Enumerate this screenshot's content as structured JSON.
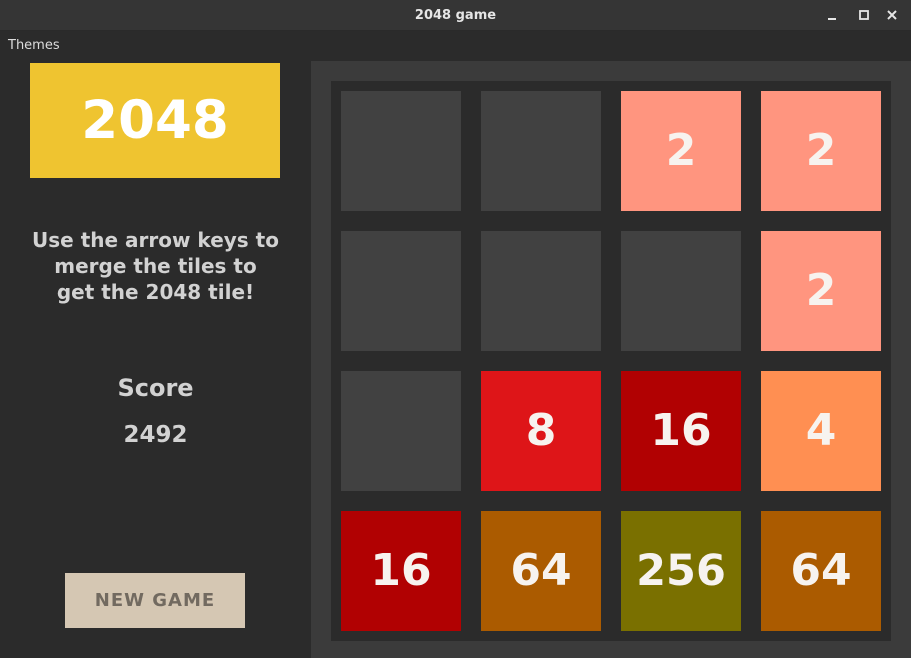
{
  "window": {
    "title": "2048 game"
  },
  "menubar": {
    "items": [
      "Themes"
    ]
  },
  "sidebar": {
    "logo": "2048",
    "instructions": [
      "Use the arrow keys to",
      "merge the tiles to",
      "get the 2048 tile!"
    ],
    "score_label": "Score",
    "score_value": "2492",
    "new_game_label": "NEW GAME"
  },
  "board": {
    "rows": [
      [
        "",
        "",
        "2",
        "2"
      ],
      [
        "",
        "",
        "",
        "2"
      ],
      [
        "",
        "8",
        "16",
        "4"
      ],
      [
        "16",
        "64",
        "256",
        "64"
      ]
    ]
  },
  "colors": {
    "empty": "#414141",
    "2": "#ff957f",
    "4": "#ff8f52",
    "8": "#de1518",
    "16": "#b10102",
    "64": "#ab5b00",
    "256": "#7a7000",
    "logo": "#efc430",
    "button": "#d5c7b3"
  }
}
